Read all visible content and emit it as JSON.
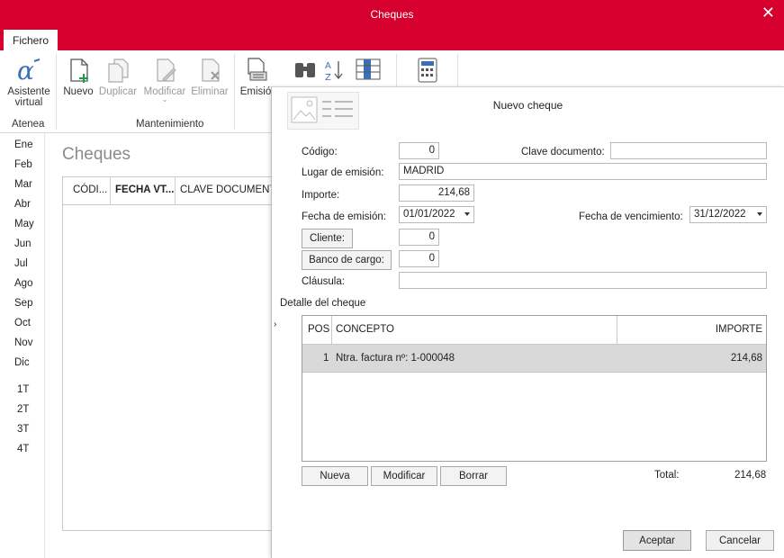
{
  "window": {
    "title": "Cheques"
  },
  "tabs": [
    {
      "label": "Fichero"
    }
  ],
  "ribbon": {
    "assistant": {
      "line1": "Asistente",
      "line2": "virtual",
      "group": "Atenea"
    },
    "mantenimiento": {
      "group": "Mantenimiento",
      "nuevo": "Nuevo",
      "duplicar": "Duplicar",
      "modificar": "Modificar",
      "eliminar": "Eliminar"
    },
    "emision": "Emisió"
  },
  "months": [
    "Ene",
    "Feb",
    "Mar",
    "Abr",
    "May",
    "Jun",
    "Jul",
    "Ago",
    "Sep",
    "Oct",
    "Nov",
    "Dic"
  ],
  "quarters": [
    "1T",
    "2T",
    "3T",
    "4T"
  ],
  "page": {
    "title": "Cheques"
  },
  "grid": {
    "columns": [
      "CÓDI...",
      "FECHA VT...",
      "CLAVE DOCUMENT"
    ]
  },
  "dialog": {
    "title": "Nuevo cheque",
    "codigo": {
      "label": "Código:",
      "value": "0"
    },
    "clave_documento": {
      "label": "Clave documento:",
      "value": ""
    },
    "lugar_emision": {
      "label": "Lugar de emisión:",
      "value": "MADRID"
    },
    "importe": {
      "label": "Importe:",
      "value": "214,68"
    },
    "fecha_emision": {
      "label": "Fecha de emisión:",
      "value": "01/01/2022"
    },
    "fecha_vencimiento": {
      "label": "Fecha de vencimiento:",
      "value": "31/12/2022"
    },
    "cliente": {
      "label": "Cliente:",
      "value": "0"
    },
    "banco_cargo": {
      "label": "Banco de cargo:",
      "value": "0"
    },
    "clausula": {
      "label": "Cláusula:",
      "value": ""
    },
    "detalle": {
      "label": "Detalle del cheque",
      "columns": {
        "pos": "POS",
        "concepto": "CONCEPTO",
        "importe": "IMPORTE"
      },
      "rows": [
        {
          "pos": "1",
          "concepto": "Ntra. factura nº: 1-000048",
          "importe": "214,68"
        }
      ]
    },
    "buttons": {
      "nueva": "Nueva",
      "modificar": "Modificar",
      "borrar": "Borrar"
    },
    "total": {
      "label": "Total:",
      "value": "214,68"
    },
    "aceptar": "Aceptar",
    "cancelar": "Cancelar"
  },
  "colors": {
    "accent": "#d6002f"
  }
}
